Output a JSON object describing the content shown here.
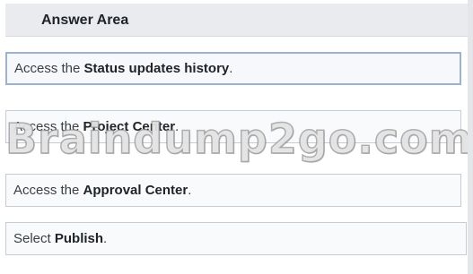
{
  "header": {
    "title": "Answer Area"
  },
  "items": [
    {
      "prefix": "Access the ",
      "bold": "Status updates history",
      "suffix": "."
    },
    {
      "prefix": "Access the ",
      "bold": "Project Center",
      "suffix": "."
    },
    {
      "prefix": "Access the ",
      "bold": "Approval Center",
      "suffix": "."
    },
    {
      "prefix": "Select ",
      "bold": "Publish",
      "suffix": "."
    }
  ],
  "watermark": {
    "text": "Braindump2go.com"
  }
}
